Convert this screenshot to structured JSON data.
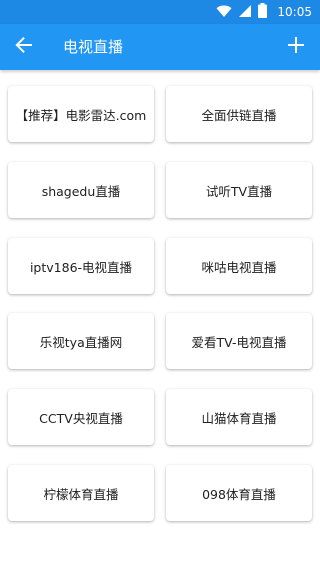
{
  "status_bar": {
    "time": "10:05",
    "icons": [
      "wifi-icon",
      "signal-icon",
      "battery-icon"
    ]
  },
  "app_bar": {
    "title": "电视直播",
    "back_icon": "arrow-left-icon",
    "add_icon": "plus-icon"
  },
  "channels": [
    {
      "label": "【推荐】电影雷达.com"
    },
    {
      "label": "全面供链直播"
    },
    {
      "label": "shagedu直播"
    },
    {
      "label": "试听TV直播"
    },
    {
      "label": "iptv186-电视直播"
    },
    {
      "label": "咪咕电视直播"
    },
    {
      "label": "乐视tya直播网"
    },
    {
      "label": "爱看TV-电视直播"
    },
    {
      "label": "CCTV央视直播"
    },
    {
      "label": "山猫体育直播"
    },
    {
      "label": "柠檬体育直播"
    },
    {
      "label": "098体育直播"
    }
  ],
  "colors": {
    "primary": "#2196f3",
    "primary_dark": "#1e88e5",
    "card_text": "#212121"
  }
}
